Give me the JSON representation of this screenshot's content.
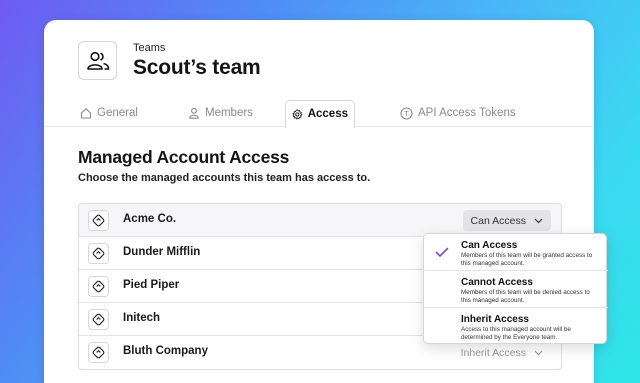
{
  "header": {
    "eyebrow": "Teams",
    "team_name": "Scout’s team"
  },
  "tabs": [
    {
      "label": "General",
      "icon": "home-icon",
      "active": false
    },
    {
      "label": "Members",
      "icon": "person-icon",
      "active": false
    },
    {
      "label": "Access",
      "icon": "gear-icon",
      "active": true
    },
    {
      "label": "API Access Tokens",
      "icon": "token-icon",
      "active": false
    }
  ],
  "section": {
    "title": "Managed Account Access",
    "description": "Choose the managed accounts this team has access to."
  },
  "accounts": [
    {
      "name": "Acme Co.",
      "access": "Can Access"
    },
    {
      "name": "Dunder Mifflin",
      "access": ""
    },
    {
      "name": "Pied Piper",
      "access": ""
    },
    {
      "name": "Initech",
      "access": ""
    },
    {
      "name": "Bluth Company",
      "access": "Inherit Access"
    }
  ],
  "dropdown": {
    "options": [
      {
        "title": "Can Access",
        "description": "Members of this team will be granted access to this managed account.",
        "selected": true
      },
      {
        "title": "Cannot Access",
        "description": "Members of this team will be denied access to this managed account.",
        "selected": false
      },
      {
        "title": "Inherit Access",
        "description": "Access to this managed account will be determined by the Everyone team.",
        "selected": false
      }
    ]
  },
  "colors": {
    "check": "#8b3fd9",
    "selected_bg": "#e4e4e8"
  }
}
